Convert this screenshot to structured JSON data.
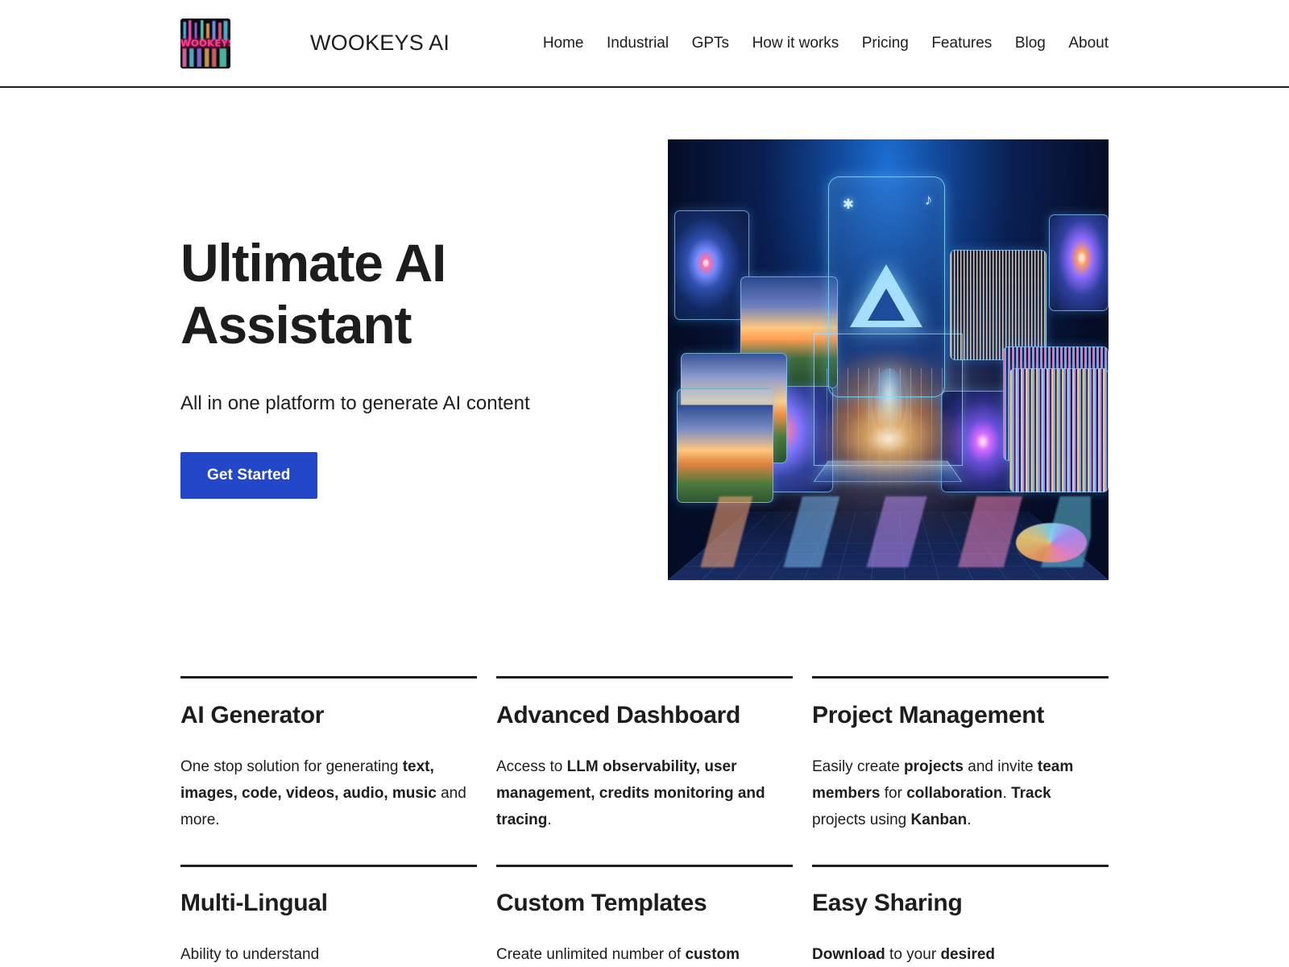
{
  "header": {
    "logo_alt": "WOOKEYS",
    "logo_word": "WOOKEYS",
    "brand_name": "WOOKEYS AI",
    "nav": [
      {
        "label": "Home"
      },
      {
        "label": "Industrial"
      },
      {
        "label": "GPTs"
      },
      {
        "label": "How it works"
      },
      {
        "label": "Pricing"
      },
      {
        "label": "Features"
      },
      {
        "label": "Blog"
      },
      {
        "label": "About"
      }
    ]
  },
  "hero": {
    "title": "Ultimate AI Assistant",
    "subtitle": "All in one platform to generate AI content",
    "cta_label": "Get Started"
  },
  "features": {
    "row1": [
      {
        "title": "AI Generator",
        "body_html": "One stop solution for generating <b>text, images, code, videos, audio, music</b> and more."
      },
      {
        "title": "Advanced Dashboard",
        "body_html": "Access to <b>LLM observability, user management, credits monitoring and tracing</b>."
      },
      {
        "title": "Project Management",
        "body_html": "Easily create <b>projects</b> and invite <b>team members</b> for <b>collaboration</b>. <b>Track</b> projects using <b>Kanban</b>."
      }
    ],
    "row2": [
      {
        "title": "Multi-Lingual",
        "body_html": "Ability to understand"
      },
      {
        "title": "Custom Templates",
        "body_html": "Create unlimited number of <b>custom</b>"
      },
      {
        "title": "Easy Sharing",
        "body_html": "<b>Download</b> to your <b>desired</b>"
      }
    ]
  },
  "colors": {
    "accent_blue": "#2347c9",
    "ink": "#1d1d1d",
    "page_bg": "#ffffff"
  }
}
